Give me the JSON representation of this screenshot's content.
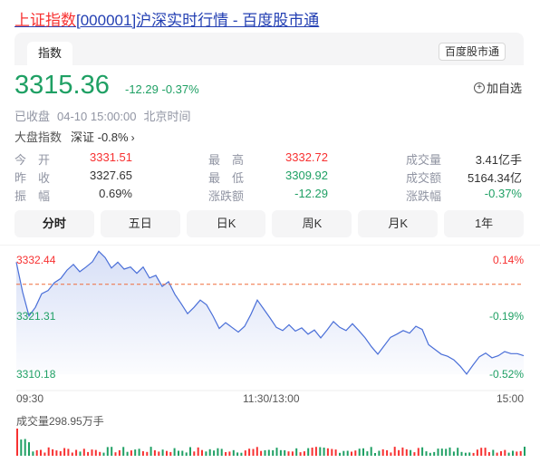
{
  "page": {
    "title_highlight": "上证指数",
    "title_rest": "[000001]沪深实时行情 - 百度股市通"
  },
  "tabs": {
    "active_label": "指数",
    "source_tag": "百度股市通"
  },
  "quote": {
    "price": "3315.36",
    "change": "-12.29",
    "change_pct": "-0.37%",
    "add_watch_label": "加自选",
    "status": "已收盘",
    "time": "04-10 15:00:00",
    "tz": "北京时间",
    "market_label": "大盘指数",
    "market_value": "深证 -0.8%"
  },
  "stats": {
    "rows": [
      [
        {
          "label": "今　开",
          "value": "3331.51",
          "color": "red"
        },
        {
          "label": "最　高",
          "value": "3332.72",
          "color": "red"
        },
        {
          "label": "成交量",
          "value": "3.41亿手",
          "color": "dark"
        }
      ],
      [
        {
          "label": "昨　收",
          "value": "3327.65",
          "color": "dark"
        },
        {
          "label": "最　低",
          "value": "3309.92",
          "color": "green"
        },
        {
          "label": "成交额",
          "value": "5164.34亿",
          "color": "dark"
        }
      ],
      [
        {
          "label": "振　幅",
          "value": "0.69%",
          "color": "dark"
        },
        {
          "label": "涨跌额",
          "value": "-12.29",
          "color": "green"
        },
        {
          "label": "涨跌幅",
          "value": "-0.37%",
          "color": "green"
        }
      ]
    ]
  },
  "period_tabs": [
    "分时",
    "五日",
    "日K",
    "周K",
    "月K",
    "1年"
  ],
  "chart_data": {
    "type": "line",
    "y_left_ticks": [
      "3332.44",
      "3321.31",
      "3310.18"
    ],
    "y_right_ticks": [
      "0.14%",
      "-0.19%",
      "-0.52%"
    ],
    "x_ticks": [
      "09:30",
      "11:30/13:00",
      "15:00"
    ],
    "ylim": [
      3310.18,
      3332.44
    ],
    "prev_close": 3327.65,
    "volume_label": "成交量298.95万手",
    "colors": {
      "line": "#4a6fd8",
      "up": "#f73131",
      "down": "#1fa064",
      "ref": "#f06b3a"
    },
    "series": [
      {
        "values": [
          3331.5,
          3325.8,
          3321.3,
          3322.9,
          3325.5,
          3326.1,
          3327.6,
          3328.4,
          3330.0,
          3331.1,
          3329.7,
          3330.6,
          3331.6,
          3333.6,
          3332.4,
          3330.4,
          3331.5,
          3330.2,
          3330.6,
          3329.4,
          3330.6,
          3328.5,
          3329.0,
          3326.9,
          3327.8,
          3325.4,
          3323.6,
          3321.7,
          3322.9,
          3324.3,
          3323.4,
          3321.3,
          3318.9,
          3320.0,
          3319.1,
          3318.2,
          3319.3,
          3321.6,
          3324.3,
          3322.6,
          3320.9,
          3319.1,
          3318.5,
          3319.6,
          3318.4,
          3319.0,
          3317.8,
          3318.6,
          3317.1,
          3318.6,
          3320.2,
          3319.1,
          3318.5,
          3319.8,
          3318.5,
          3317.1,
          3315.4,
          3314.0,
          3315.6,
          3317.2,
          3317.8,
          3318.5,
          3318.0,
          3319.3,
          3318.7,
          3315.8,
          3314.9,
          3314.0,
          3313.6,
          3312.9,
          3311.7,
          3310.2,
          3311.9,
          3313.5,
          3314.2,
          3313.3,
          3313.7,
          3314.5,
          3314.1,
          3314.1,
          3313.7
        ]
      }
    ]
  }
}
